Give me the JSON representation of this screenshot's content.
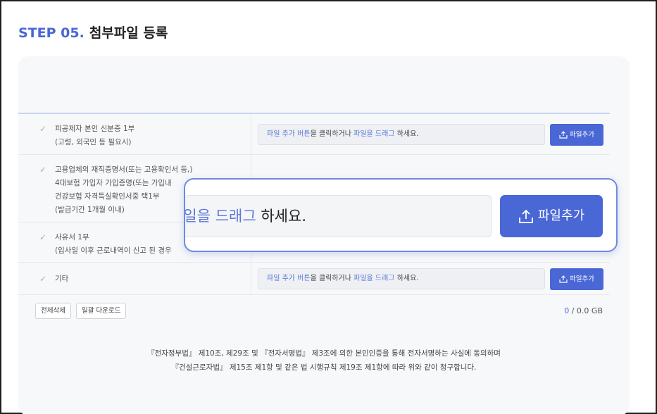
{
  "header": {
    "step": "STEP 05.",
    "title": "첨부파일 등록"
  },
  "rows": [
    {
      "lines": [
        "피공제자 본인 신분증 1부",
        "(고령, 외국인 등 필요시)"
      ],
      "has_upload": true
    },
    {
      "lines": [
        "고용업체의 재직증명서(또는 고용확인서 등,)",
        "4대보험 가입자 가입증명(또는 가입내",
        "건강보험 자격득실확인서중 택1부",
        "(발급기간 1개월 이내)"
      ],
      "has_upload": false
    },
    {
      "lines": [
        "사유서 1부",
        "(입사일 이후 근로내역이 신고 된 경우"
      ],
      "has_upload": false
    },
    {
      "lines": [
        "기타"
      ],
      "has_upload": true
    }
  ],
  "upload": {
    "link1": "파일 추가 버튼",
    "mid": "을 클릭하거나 ",
    "link2": "파일을 드래그",
    "end": " 하세요.",
    "button_label": "파일추가"
  },
  "actions": {
    "delete_all": "전체삭제",
    "download_all": "일괄 다운로드"
  },
  "storage": {
    "used": "0",
    "total": " / 0.0 GB"
  },
  "agreement": {
    "line1": "『전자정부법』 제10조, 제29조 및 『전자서명법』 제3조에 의한 본인인증을 통해 전자서명하는 사실에 동의하며",
    "line2": "『건설근로자법』 제15조 제1항 및 같은 법 시행규칙 제19조 제1항에 따라 위와 같이 청구합니다."
  },
  "zoom": {
    "field_link": "일을 드래그",
    "field_end": " 하세요.",
    "button_label": "파일추가"
  },
  "colors": {
    "accent": "#4a67d6",
    "link": "#5a78d8",
    "panel_bg": "#f7f8fa",
    "zoom_border": "#6e8ae6"
  },
  "icons": {
    "check": "check-icon",
    "upload": "upload-icon"
  }
}
